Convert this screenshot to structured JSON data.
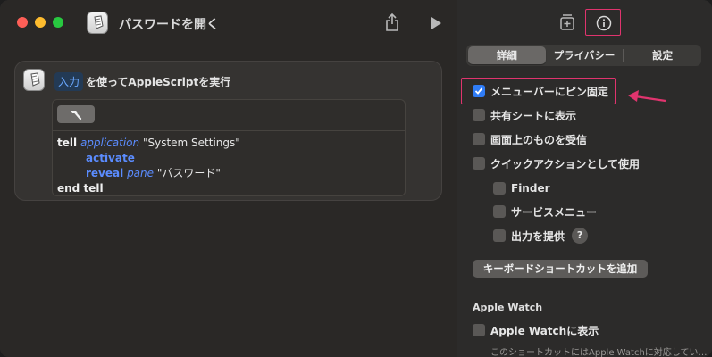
{
  "window": {
    "title": "パスワードを開く"
  },
  "toolbar": {
    "share_icon": "share-icon",
    "run_icon": "play-icon"
  },
  "action": {
    "input_token": "入力",
    "header_text": "を使ってAppleScriptを実行",
    "compile_icon": "hammer-icon",
    "script_lines": [
      {
        "parts": [
          "tell",
          "application",
          "\"System Settings\""
        ]
      },
      {
        "parts": [
          "activate"
        ]
      },
      {
        "parts": [
          "reveal",
          "pane",
          "\"パスワード\""
        ]
      },
      {
        "parts": [
          "end tell"
        ]
      }
    ]
  },
  "inspector": {
    "tabs": [
      "詳細",
      "プライバシー",
      "設定"
    ],
    "active_tab": "詳細",
    "options": [
      {
        "label": "メニューバーにピン固定",
        "checked": true
      },
      {
        "label": "共有シートに表示",
        "checked": false
      },
      {
        "label": "画面上のものを受信",
        "checked": false
      },
      {
        "label": "クイックアクションとして使用",
        "checked": false
      },
      {
        "label": "Finder",
        "checked": false
      },
      {
        "label": "サービスメニュー",
        "checked": false
      },
      {
        "label": "出力を提供",
        "checked": false
      }
    ],
    "help_label": "?",
    "shortcut_button": "キーボードショートカットを追加",
    "watch_section": "Apple Watch",
    "watch_option": {
      "label": "Apple Watchに表示",
      "checked": false
    },
    "watch_note": "このショートカットにはApple Watchに対応してい…"
  },
  "colors": {
    "accent": "#2f7cf6",
    "highlight": "#e0346e",
    "token_bg": "#233a55",
    "token_text": "#6aa8ff"
  }
}
